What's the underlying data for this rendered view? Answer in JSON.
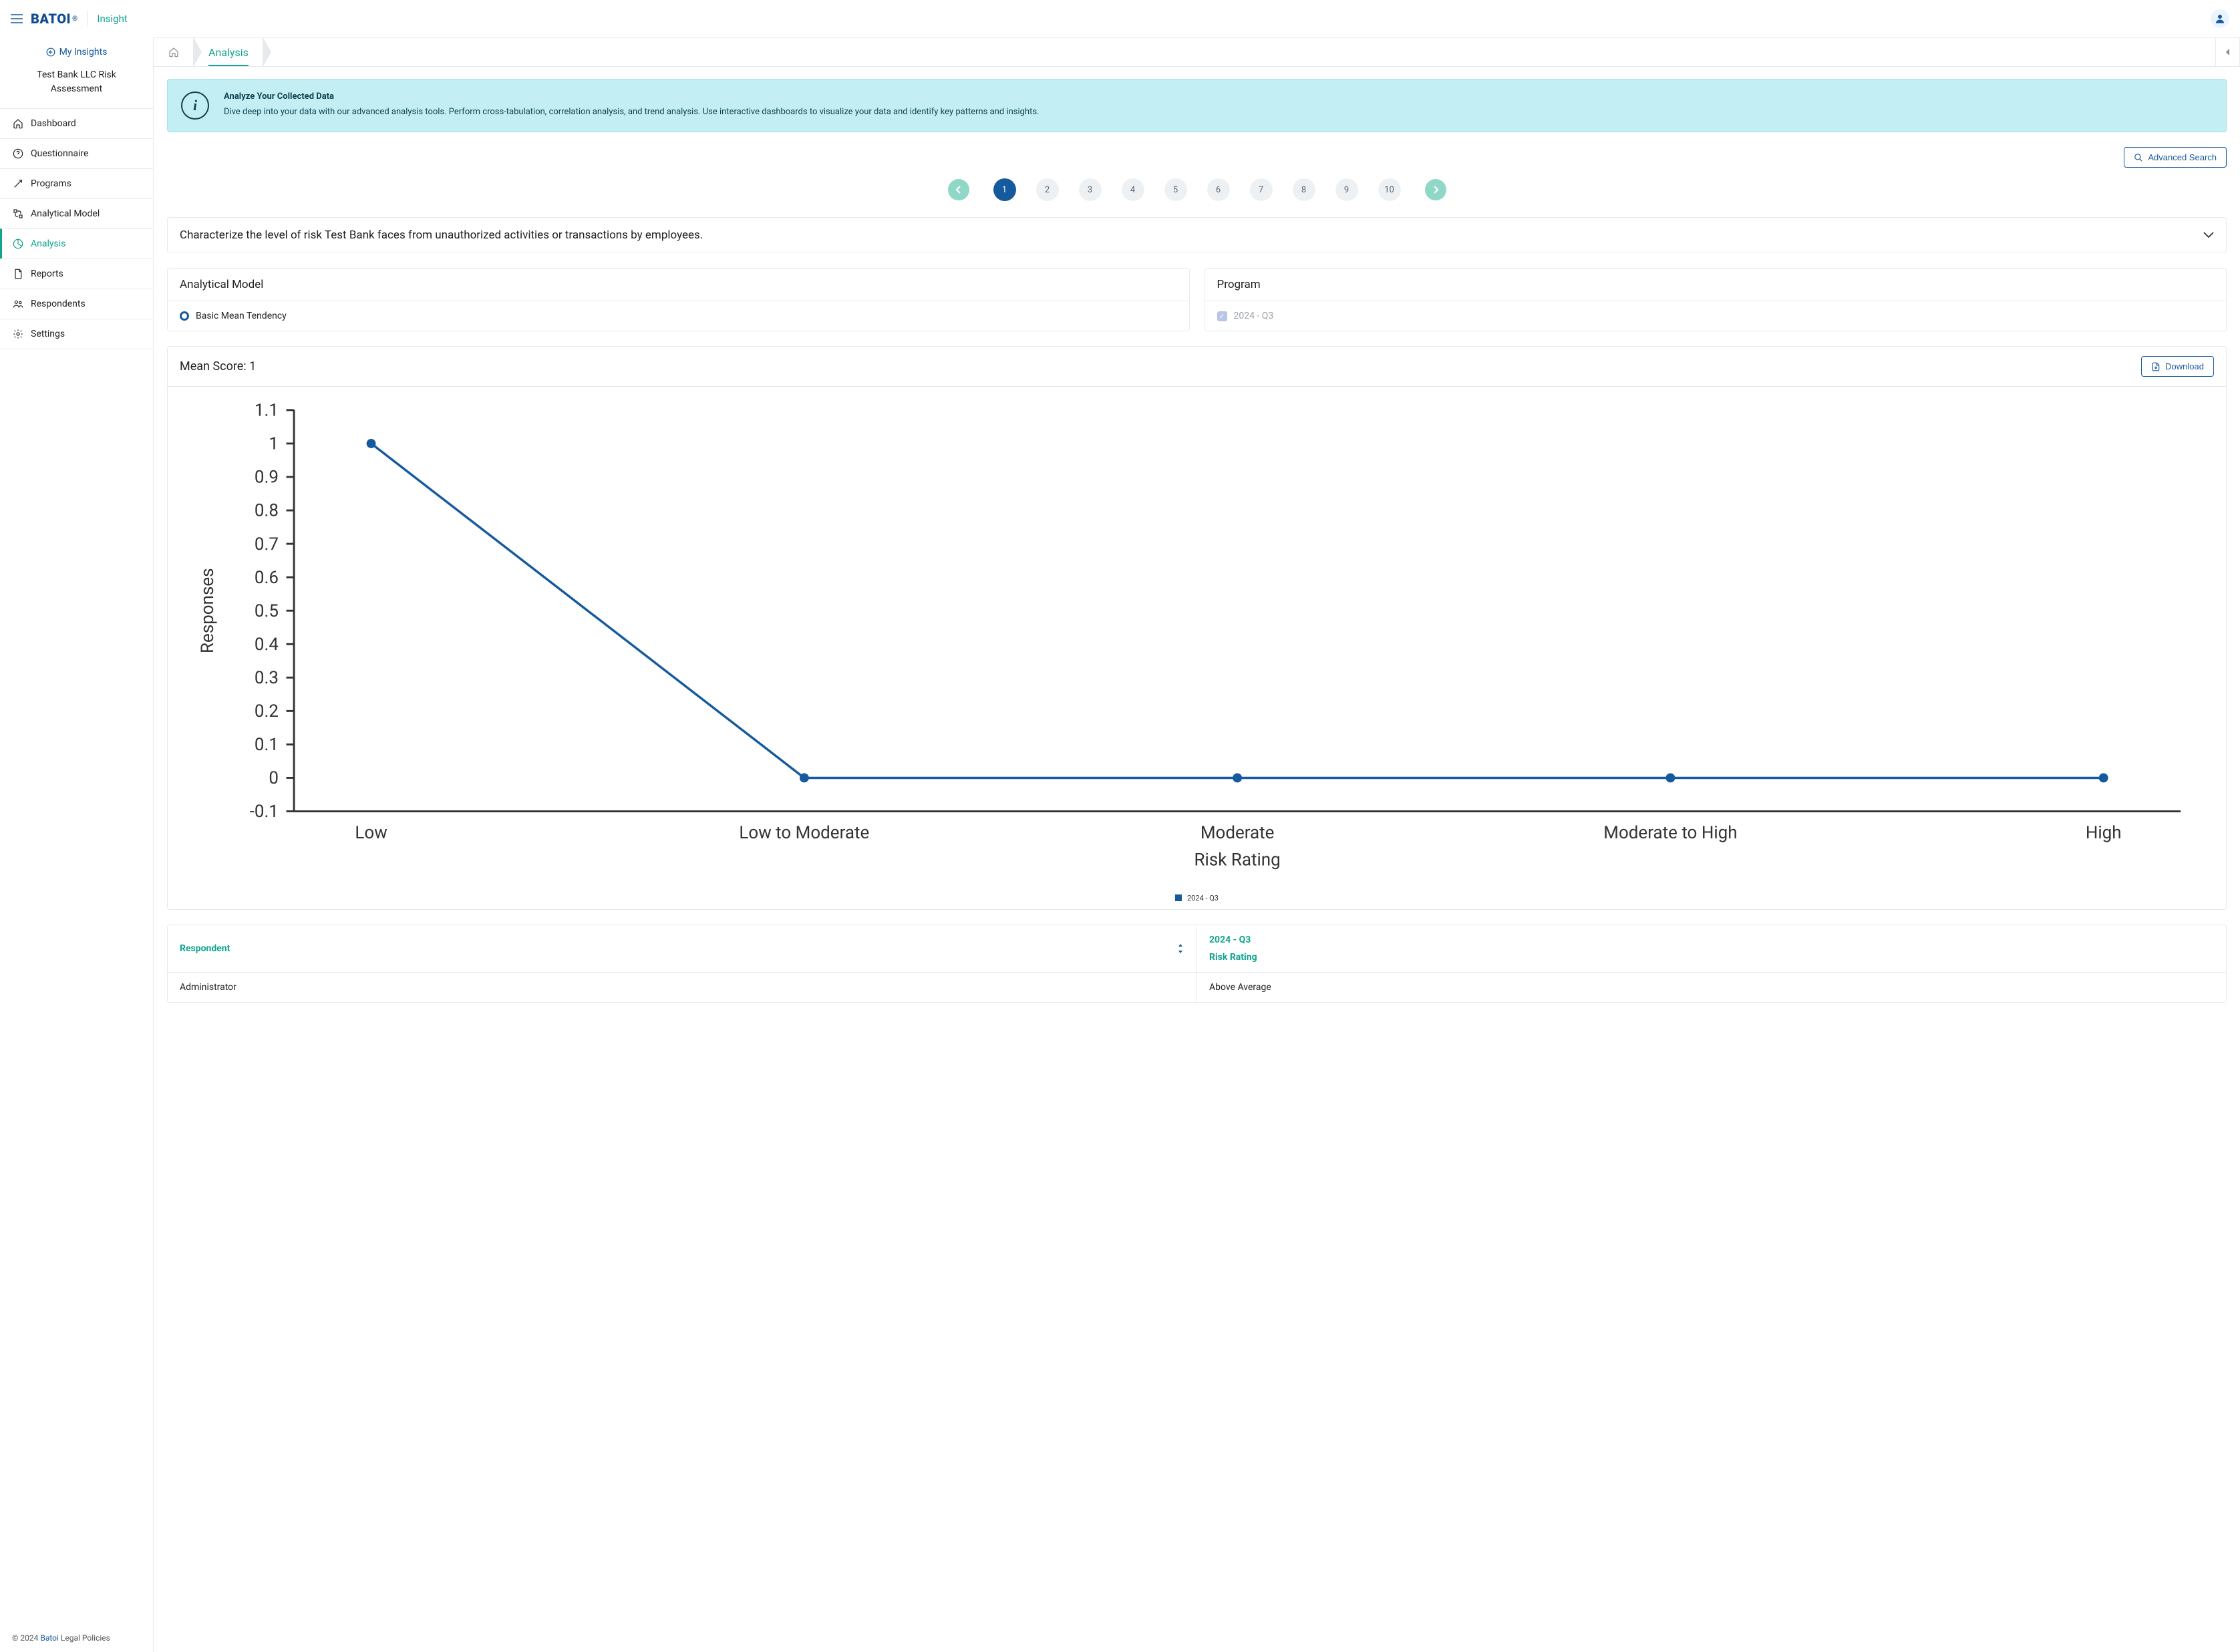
{
  "brand": {
    "logo_text": "BATOI",
    "reg": "®",
    "app_name": "Insight"
  },
  "back_link": "My Insights",
  "project_title": "Test Bank LLC Risk Assessment",
  "sidebar": {
    "items": [
      {
        "icon": "home-icon",
        "label": "Dashboard"
      },
      {
        "icon": "help-icon",
        "label": "Questionnaire"
      },
      {
        "icon": "programs-icon",
        "label": "Programs"
      },
      {
        "icon": "model-icon",
        "label": "Analytical Model"
      },
      {
        "icon": "analysis-icon",
        "label": "Analysis",
        "active": true
      },
      {
        "icon": "reports-icon",
        "label": "Reports"
      },
      {
        "icon": "respondents-icon",
        "label": "Respondents"
      },
      {
        "icon": "settings-icon",
        "label": "Settings"
      }
    ]
  },
  "footer": {
    "copyright_prefix": "© 2024 ",
    "link": "Batoi",
    "suffix": " Legal Policies"
  },
  "breadcrumb": {
    "home": "home",
    "current": "Analysis"
  },
  "banner": {
    "title": "Analyze Your Collected Data",
    "body": "Dive deep into your data with our advanced analysis tools. Perform cross-tabulation, correlation analysis, and trend analysis. Use interactive dashboards to visualize your data and identify key patterns and insights."
  },
  "actions": {
    "advanced_search": "Advanced Search",
    "download": "Download"
  },
  "paginator": {
    "pages": [
      "1",
      "2",
      "3",
      "4",
      "5",
      "6",
      "7",
      "8",
      "9",
      "10"
    ],
    "active_index": 0
  },
  "question": {
    "text": "Characterize the level of risk Test Bank faces from unauthorized activities or transactions by employees."
  },
  "panels": {
    "model": {
      "title": "Analytical Model",
      "option": "Basic Mean Tendency"
    },
    "program": {
      "title": "Program",
      "option": "2024 - Q3"
    }
  },
  "score": {
    "label": "Mean Score: 1"
  },
  "chart_data": {
    "type": "line",
    "categories": [
      "Low",
      "Low to Moderate",
      "Moderate",
      "Moderate to High",
      "High"
    ],
    "series": [
      {
        "name": "2024 - Q3",
        "values": [
          1,
          0,
          0,
          0,
          0
        ]
      }
    ],
    "xlabel": "Risk Rating",
    "ylabel": "Responses",
    "ylim": [
      -0.1,
      1.1
    ],
    "y_ticks": [
      -0.1,
      0,
      0.1,
      0.2,
      0.3,
      0.4,
      0.5,
      0.6,
      0.7,
      0.8,
      0.9,
      1,
      1.1
    ],
    "title": "",
    "legend_position": "bottom"
  },
  "table": {
    "headers": {
      "respondent": "Respondent",
      "period": "2024 - Q3",
      "risk_rating": "Risk Rating"
    },
    "rows": [
      {
        "respondent": "Administrator",
        "rating": "Above Average"
      }
    ]
  }
}
